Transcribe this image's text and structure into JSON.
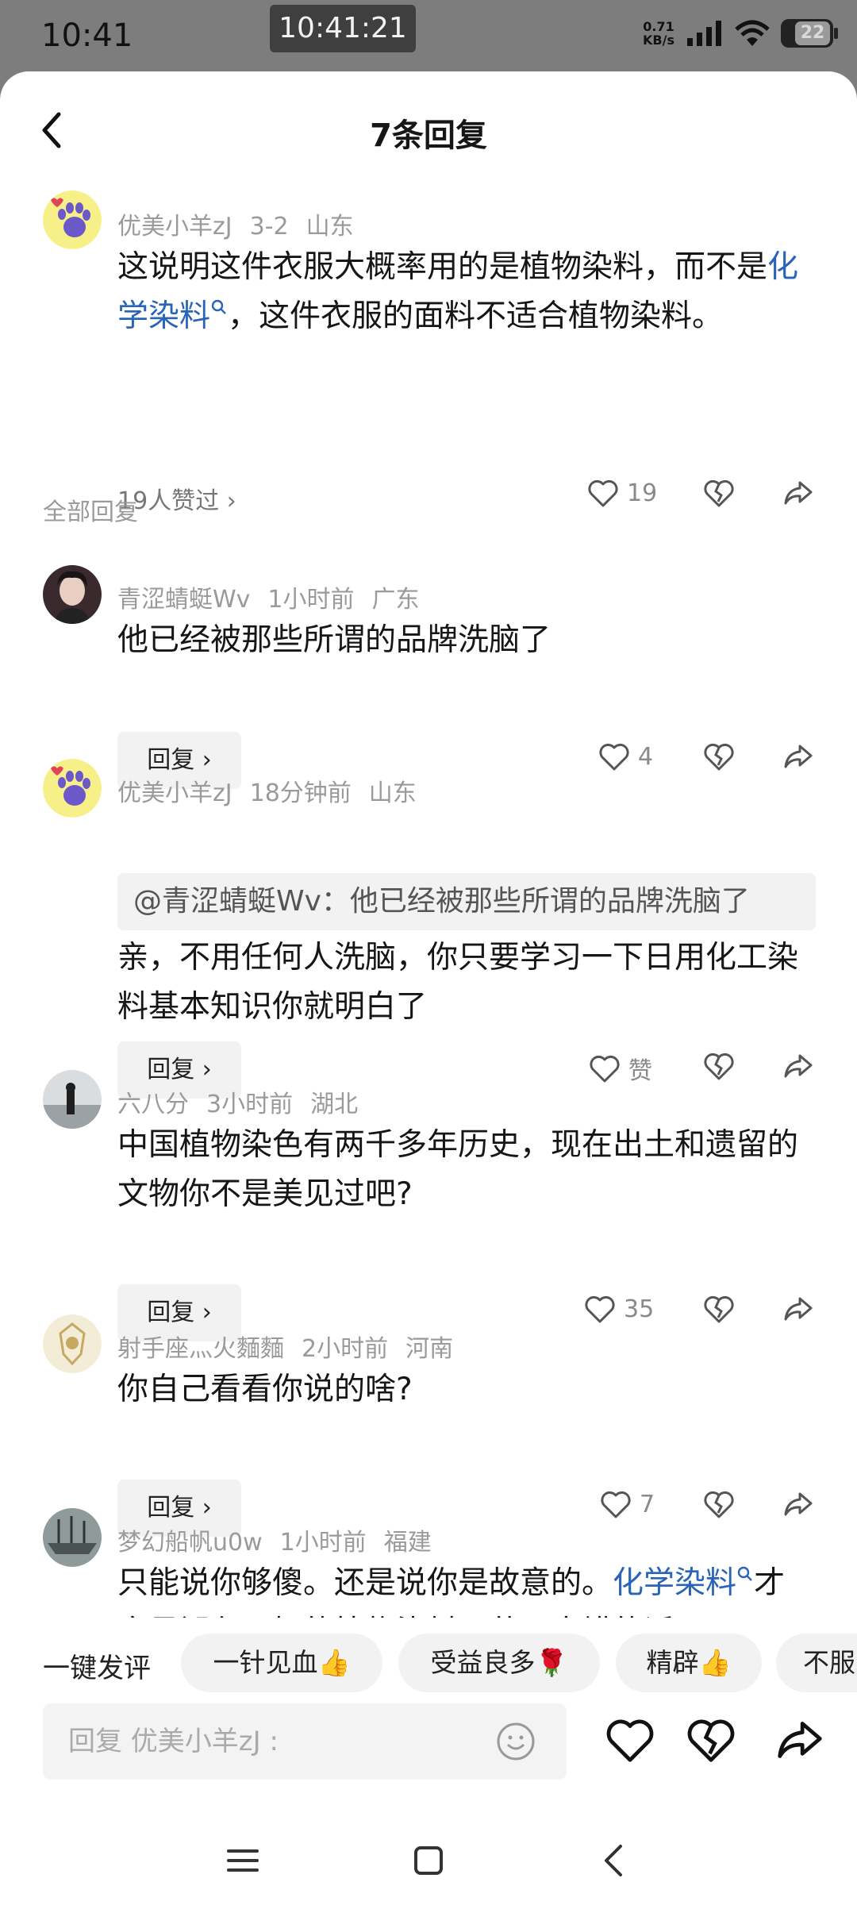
{
  "status_bar": {
    "time": "10:41",
    "clock_pill": "10:41:21",
    "net_speed_value": "0.71",
    "net_speed_unit": "KB/s",
    "battery": "22"
  },
  "header": {
    "title": "7条回复"
  },
  "main_comment": {
    "user": "优美小羊zJ",
    "date": "3-2",
    "location": "山东",
    "text_before": "这说明这件衣服大概率用的是植物染料，而不是",
    "link": "化学染料",
    "text_after": "，这件衣服的面料不适合植物染料。",
    "likes_summary": "19人赞过 ›",
    "like_count": "19"
  },
  "section_label": "全部回复",
  "replies": [
    {
      "user": "青涩蜻蜓Wv",
      "time": "1小时前",
      "location": "广东",
      "text": "他已经被那些所谓的品牌洗脑了",
      "reply_label": "回复 ›",
      "like_count": "4"
    },
    {
      "user": "优美小羊zJ",
      "time": "18分钟前",
      "location": "山东",
      "quote": "@青涩蜻蜓Wv：他已经被那些所谓的品牌洗脑了",
      "text": "亲，不用任何人洗脑，你只要学习一下日用化工染料基本知识你就明白了",
      "reply_label": "回复 ›",
      "like_count": "赞"
    },
    {
      "user": "六八分",
      "time": "3小时前",
      "location": "湖北",
      "text": "中国植物染色有两千多年历史，现在出土和遗留的文物你不是美见过吧?",
      "reply_label": "回复 ›",
      "like_count": "35"
    },
    {
      "user": "射手座灬火麵麵",
      "time": "2小时前",
      "location": "河南",
      "text": "你自己看看你说的啥?",
      "reply_label": "回复 ›",
      "like_count": "7"
    },
    {
      "user": "梦幻船帆u0w",
      "time": "1小时前",
      "location": "福建",
      "text_before": "只能说你够傻。还是说你是故意的。",
      "link": "化学染料",
      "text_after": "才容易褪色，好的植物染料工艺不出错的话"
    }
  ],
  "quick_bar": {
    "label": "一键发评",
    "chips": [
      "一针见血👍",
      "受益良多🌹",
      "精辟👍",
      "不服"
    ]
  },
  "reply_input": {
    "placeholder": "回复 优美小羊zJ :"
  },
  "icons": {
    "back": "chevron-left-icon",
    "like": "heart-icon",
    "dislike": "broken-heart-icon",
    "share": "share-arrow-icon",
    "emoji": "smiley-icon",
    "menu": "menu-icon",
    "home": "square-home-icon",
    "nav_back": "nav-back-icon"
  },
  "colors": {
    "link": "#2a64b8",
    "chip_bg": "#f2f2f2",
    "status_bg": "#7d7d7d"
  }
}
